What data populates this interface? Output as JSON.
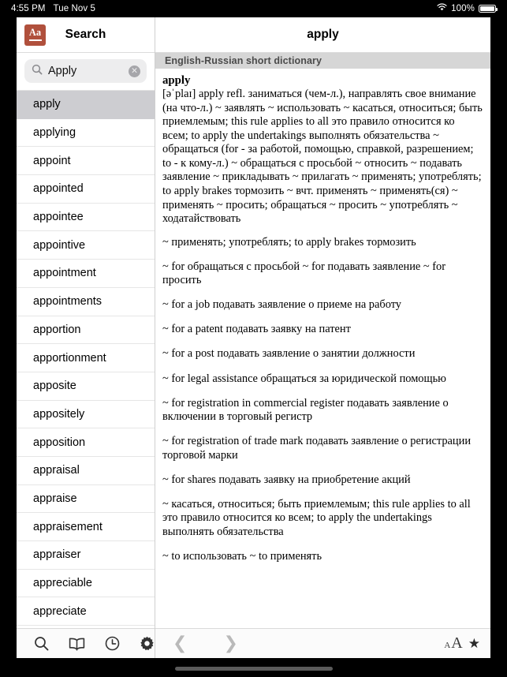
{
  "statusbar": {
    "time": "4:55 PM",
    "date": "Tue Nov 5",
    "wifi_icon": "wifi-icon",
    "battery_percent": "100%",
    "battery_icon": "battery-full-icon"
  },
  "left_pane": {
    "app_icon": {
      "name": "dictionary-app-icon",
      "letters": "Aa",
      "color": "#b0503c"
    },
    "title": "Search",
    "search": {
      "icon": "search-icon",
      "value": "Apply",
      "placeholder": "Search",
      "clear_icon": "clear-circle-icon",
      "clear_glyph": "✕"
    },
    "results": [
      {
        "label": "apply",
        "selected": true
      },
      {
        "label": "applying",
        "selected": false
      },
      {
        "label": "appoint",
        "selected": false
      },
      {
        "label": "appointed",
        "selected": false
      },
      {
        "label": "appointee",
        "selected": false
      },
      {
        "label": "appointive",
        "selected": false
      },
      {
        "label": "appointment",
        "selected": false
      },
      {
        "label": "appointments",
        "selected": false
      },
      {
        "label": "apportion",
        "selected": false
      },
      {
        "label": "apportionment",
        "selected": false
      },
      {
        "label": "apposite",
        "selected": false
      },
      {
        "label": "appositely",
        "selected": false
      },
      {
        "label": "apposition",
        "selected": false
      },
      {
        "label": "appraisal",
        "selected": false
      },
      {
        "label": "appraise",
        "selected": false
      },
      {
        "label": "appraisement",
        "selected": false
      },
      {
        "label": "appraiser",
        "selected": false
      },
      {
        "label": "appreciable",
        "selected": false
      },
      {
        "label": "appreciate",
        "selected": false
      }
    ],
    "toolbar": [
      {
        "icon": "search-icon",
        "name": "toolbar-search-button"
      },
      {
        "icon": "book-icon",
        "name": "toolbar-dictionaries-button"
      },
      {
        "icon": "clock-icon",
        "name": "toolbar-history-button"
      },
      {
        "icon": "gear-icon",
        "name": "toolbar-settings-button"
      }
    ]
  },
  "right_pane": {
    "title": "apply",
    "dictionary_name": "English-Russian short dictionary",
    "entry": {
      "headword": "apply",
      "paragraphs": [
        "[əˈplaɪ] apply refl. заниматься (чем-л.), направлять свое внимание (на что-л.) ~ заявлять ~ использовать ~ касаться, относиться; быть приемлемым; this rule applies to all это правило относится ко всем; to apply the undertakings выполнять обязательства ~ обращаться (for - за работой, помощью, справкой, разрешением; to - к кому-л.) ~ обращаться с просьбой ~ относить ~ подавать заявление ~ прикладывать ~ прилагать ~ применять; употреблять; to apply brakes тормозить ~ вчт. применять ~ применять(ся) ~ применять ~ просить; обращаться ~ просить ~ употреблять ~ ходатайствовать",
        "~ применять; употреблять; to apply brakes тормозить",
        "~ for обращаться с просьбой ~ for подавать заявление ~ for просить",
        "~ for a job подавать заявление о приеме на работу",
        "~ for a patent подавать заявку на патент",
        "~ for a post подавать заявление о занятии должности",
        "~ for legal assistance обращаться за юридической помощью",
        "~ for registration in commercial register подавать заявление о включении в торговый регистр",
        "~ for registration of trade mark подавать заявление о регистрации торговой марки",
        "~ for shares подавать заявку на приобретение акций",
        "~ касаться, относиться; быть приемлемым; this rule applies to all это правило относится ко всем; to apply the undertakings выполнять обязательства",
        "~ to использовать ~ to применять"
      ]
    },
    "toolbar": {
      "back_glyph": "❮",
      "forward_glyph": "❯",
      "font_small": "A",
      "font_big": "A",
      "star_glyph": "★"
    }
  }
}
